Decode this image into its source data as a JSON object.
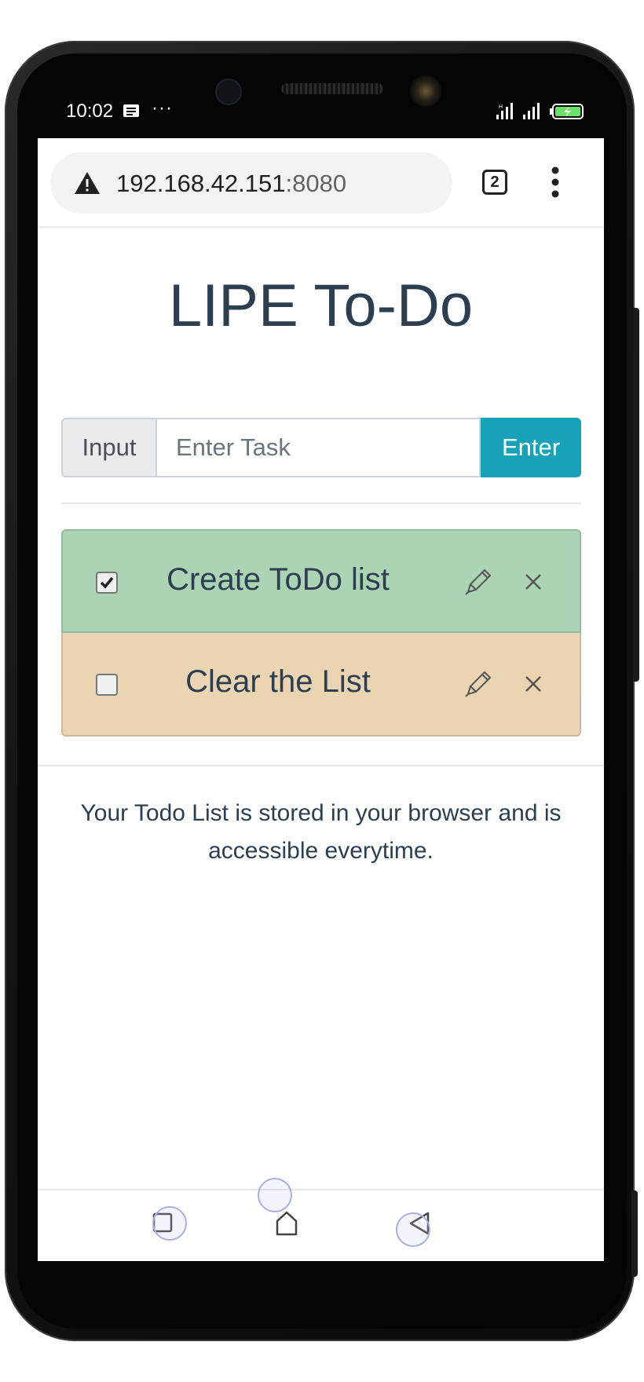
{
  "status_bar": {
    "time": "10:02",
    "icons": [
      "message-notification-icon",
      "more-notifications-icon",
      "signal-icon",
      "signal-icon",
      "battery-charging-icon"
    ],
    "more": "···"
  },
  "browser": {
    "url_host": "192.168.42.151",
    "url_port": ":8080",
    "tab_count": "2",
    "icons": [
      "not-secure-warning-icon",
      "tabs-icon",
      "overflow-menu-icon"
    ]
  },
  "app": {
    "title": "LIPE To-Do",
    "input_label": "Input",
    "input_placeholder": "Enter Task",
    "input_value": "",
    "enter_label": "Enter",
    "todos": [
      {
        "text": "Create ToDo list",
        "checked": true,
        "color": "#aad4b4"
      },
      {
        "text": "Clear the List",
        "checked": false,
        "color": "#ebd4b2"
      }
    ],
    "footer": "Your Todo List is stored in your browser and is accessible everytime."
  },
  "colors": {
    "title": "#2c3e50",
    "enter_button": "#17a2b8",
    "done_item": "#aad4b4",
    "pending_item": "#ebd4b2"
  },
  "nav_bar": {
    "icons": [
      "recents-square-icon",
      "home-icon",
      "back-triangle-icon"
    ]
  }
}
